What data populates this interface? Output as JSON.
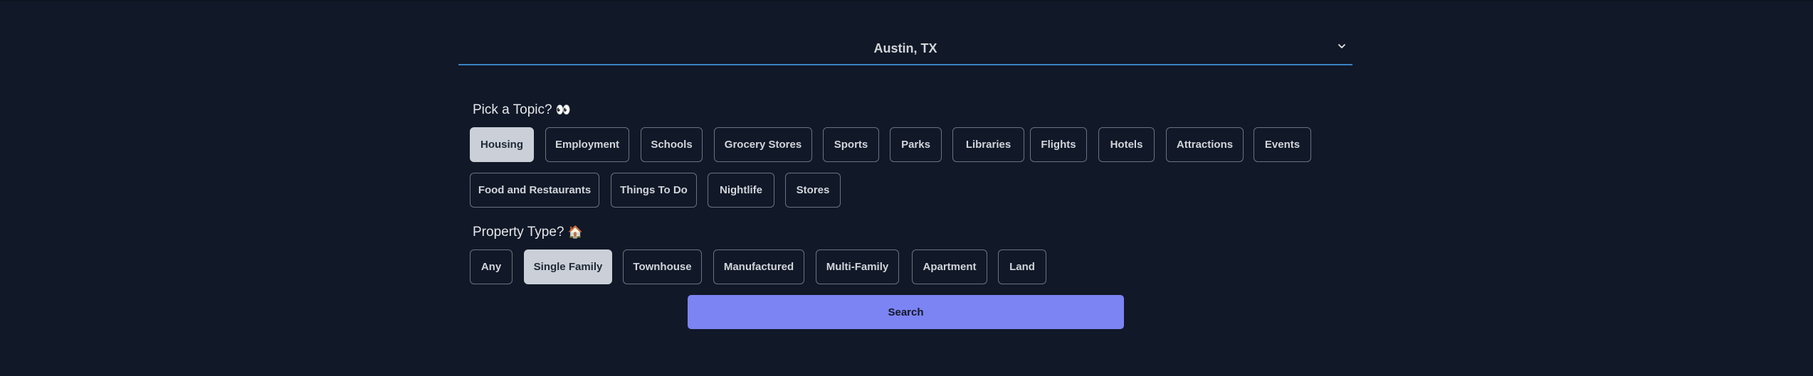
{
  "location": {
    "value": "Austin, TX",
    "chevron_icon": "chevron-down-icon"
  },
  "topic": {
    "title": "Pick a Topic?",
    "emoji": "👀",
    "selected": "Housing",
    "row1": [
      "Housing",
      "Employment",
      "Schools",
      "Grocery Stores",
      "Sports",
      "Parks",
      "Libraries",
      "Flights",
      "Hotels",
      "Attractions",
      "Events"
    ],
    "row2": [
      "Food and Restaurants",
      "Things To Do",
      "Nightlife",
      "Stores"
    ]
  },
  "property_type": {
    "title": "Property Type?",
    "emoji": "🏠",
    "selected": "Single Family",
    "options": [
      "Any",
      "Single Family",
      "Townhouse",
      "Manufactured",
      "Multi-Family",
      "Apartment",
      "Land"
    ]
  },
  "search": {
    "label": "Search"
  },
  "colors": {
    "background": "#111827",
    "accent": "#7c83f3",
    "underline": "#3b82c4",
    "chip_selected": "#cbd0d8"
  }
}
